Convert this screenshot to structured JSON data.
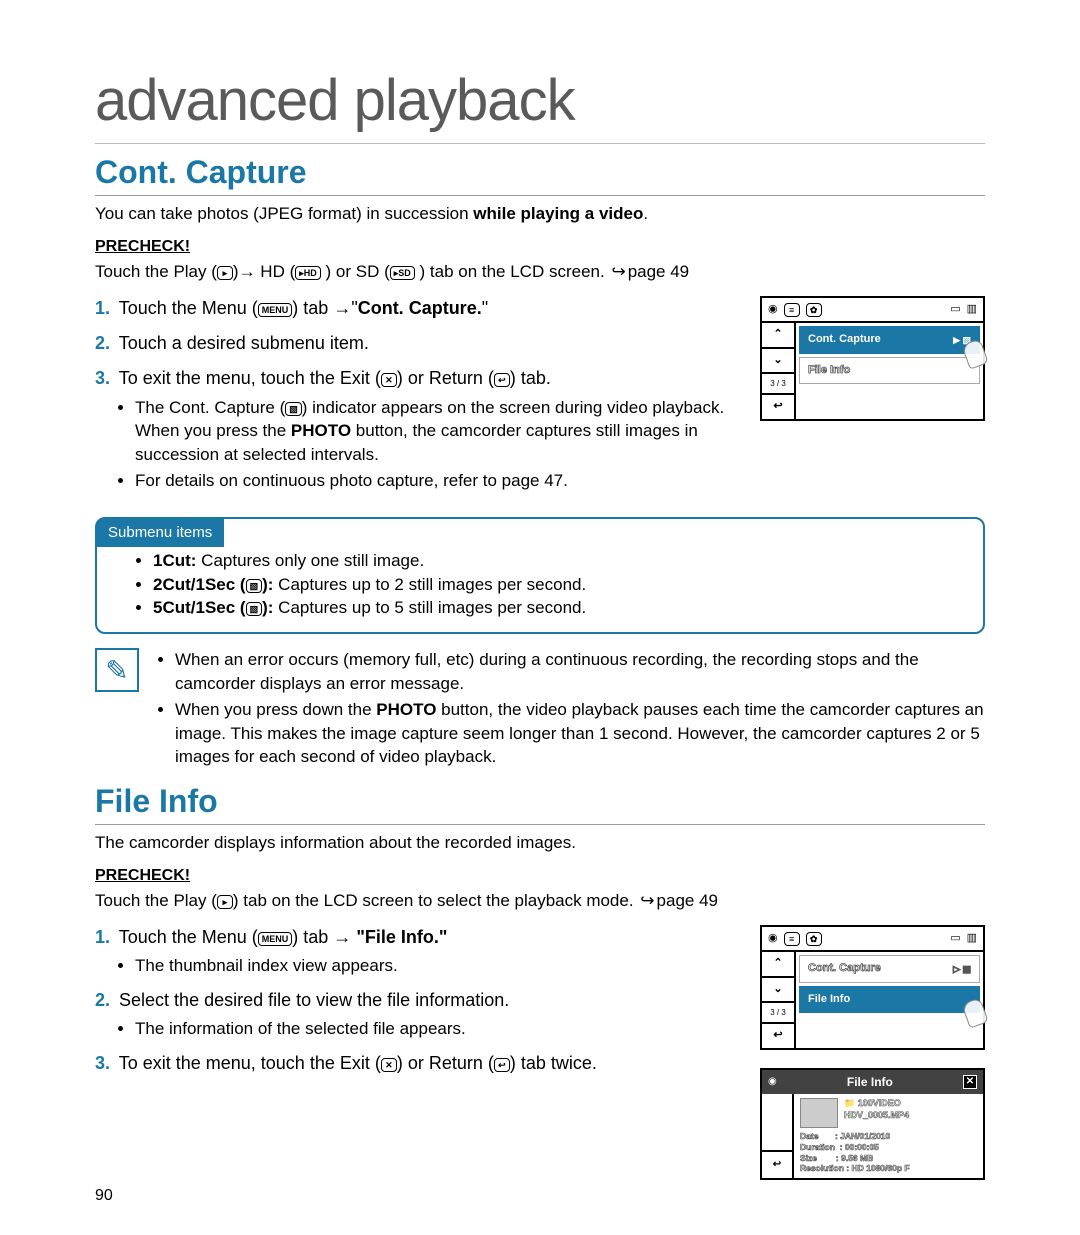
{
  "page_title": "advanced playback",
  "page_number": "90",
  "section1": {
    "title": "Cont. Capture",
    "intro_pre": "You can take photos (JPEG format) in succession ",
    "intro_bold": "while playing a video",
    "intro_post": ".",
    "precheck_label": "PRECHECK!",
    "precheck_pre": "Touch the Play (",
    "precheck_mid1": ")",
    "precheck_mid2": " HD (",
    "precheck_hd": "HD",
    "precheck_mid3": " ) or SD (",
    "precheck_sd": "SD",
    "precheck_mid4": " ) tab on the LCD screen. ",
    "precheck_ref": "page 49",
    "step1_pre": "Touch the Menu (",
    "step1_menu": "MENU",
    "step1_mid": ") tab ",
    "step1_q1": "\"",
    "step1_bold": "Cont. Capture.",
    "step1_q2": "\"",
    "step2": "Touch a desired submenu item.",
    "step3_pre": "To exit the menu, touch the Exit (",
    "step3_x": "✕",
    "step3_mid": ") or Return (",
    "step3_ret": "↩",
    "step3_post": ") tab.",
    "step3_b1_pre": "The Cont. Capture (",
    "step3_b1_ic": "▧",
    "step3_b1_mid": ") indicator appears on the screen during video playback. When you press the ",
    "step3_b1_bold": "PHOTO",
    "step3_b1_post": " button, the camcorder captures still images in succession at selected intervals.",
    "step3_b2": "For details on continuous photo capture, refer to page 47.",
    "submenu_label": "Submenu items",
    "sub1_b": "1Cut:",
    "sub1_t": " Captures only one still image.",
    "sub2_b": "2Cut/1Sec (",
    "sub2_ic": "▧",
    "sub2_b2": "):",
    "sub2_t": " Captures up to 2 still images per second.",
    "sub3_b": "5Cut/1Sec (",
    "sub3_ic": "▧",
    "sub3_b2": "):",
    "sub3_t": " Captures up to 5 still images per second.",
    "note1": "When an error occurs (memory full, etc) during a continuous recording, the recording stops and the camcorder displays an error message.",
    "note2_pre": "When you press down the ",
    "note2_bold": "PHOTO",
    "note2_post": " button, the video playback pauses each time the camcorder captures an image. This makes the image capture seem longer than 1 second. However, the camcorder captures 2 or 5 images for each second of video playback."
  },
  "section2": {
    "title": "File Info",
    "intro": "The camcorder displays information about the recorded images.",
    "precheck_label": "PRECHECK!",
    "precheck_pre": "Touch the Play (",
    "precheck_post": ") tab on the LCD screen to select the playback mode. ",
    "precheck_ref": "page 49",
    "step1_pre": "Touch the Menu (",
    "step1_menu": "MENU",
    "step1_mid": ") tab ",
    "step1_bold": " \"File Info.\"",
    "step1_b1": "The thumbnail index view appears.",
    "step2": "Select the desired file to view the file information.",
    "step2_b1": "The information of the selected file appears.",
    "step3_pre": "To exit the menu, touch the Exit (",
    "step3_x": "✕",
    "step3_mid": ") or Return (",
    "step3_ret": "↩",
    "step3_post": ") tab twice."
  },
  "lcd1": {
    "counter": "3 / 3",
    "row1": "Cont. Capture",
    "row1_icon": "▧",
    "row2": "File Info"
  },
  "lcd2": {
    "counter": "3 / 3",
    "row1": "Cont. Capture",
    "row1_icon": "▧",
    "row2": "File Info"
  },
  "fileinfo": {
    "title": "File Info",
    "folder": "100VIDEO",
    "filename": "HDV_0005.MP4",
    "date_l": "Date",
    "date_v": ": JAN/01/2010",
    "dur_l": "Duration",
    "dur_v": ": 00:00:05",
    "size_l": "Size",
    "size_v": ": 9.56 MB",
    "res_l": "Resolution",
    "res_v": ": HD 1080/60p F"
  }
}
